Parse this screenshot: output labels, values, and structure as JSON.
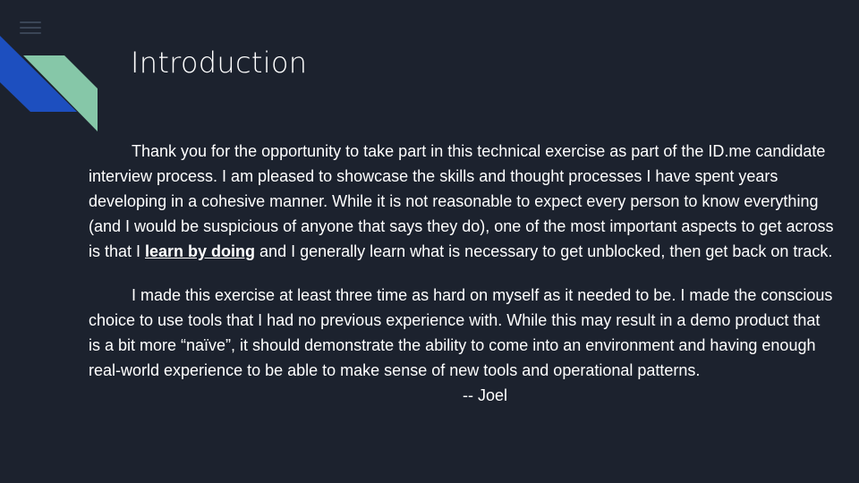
{
  "slide": {
    "title": "Introduction",
    "paragraph1": {
      "before": "Thank you for the opportunity to take part in this technical exercise as part of the ID.me candidate interview process. I am pleased to showcase the skills and thought processes I have spent years developing in a cohesive manner. While it is not reasonable to expect every person to know everything (and I would be suspicious of anyone that says they do), one of the most important aspects to get across is that I ",
      "emphasis": "learn by doing",
      "after": " and I generally learn what is necessary to get unblocked, then get back on track."
    },
    "paragraph2": {
      "text": "I made this exercise at least three time as hard on myself as it needed to be. I made the conscious choice to use tools that I had no previous experience with. While this may result in a demo product that is a bit more “naïve”, it should demonstrate the ability to come into an environment and having enough real-world experience to be able to make sense of new tools and operational patterns.",
      "signature": "-- Joel"
    }
  },
  "icons": {
    "menu": "hamburger-menu-icon"
  },
  "colors": {
    "background": "#1c222e",
    "text": "#ffffff",
    "accent_blue": "#1d4fbf",
    "accent_green": "#86c7a8"
  }
}
